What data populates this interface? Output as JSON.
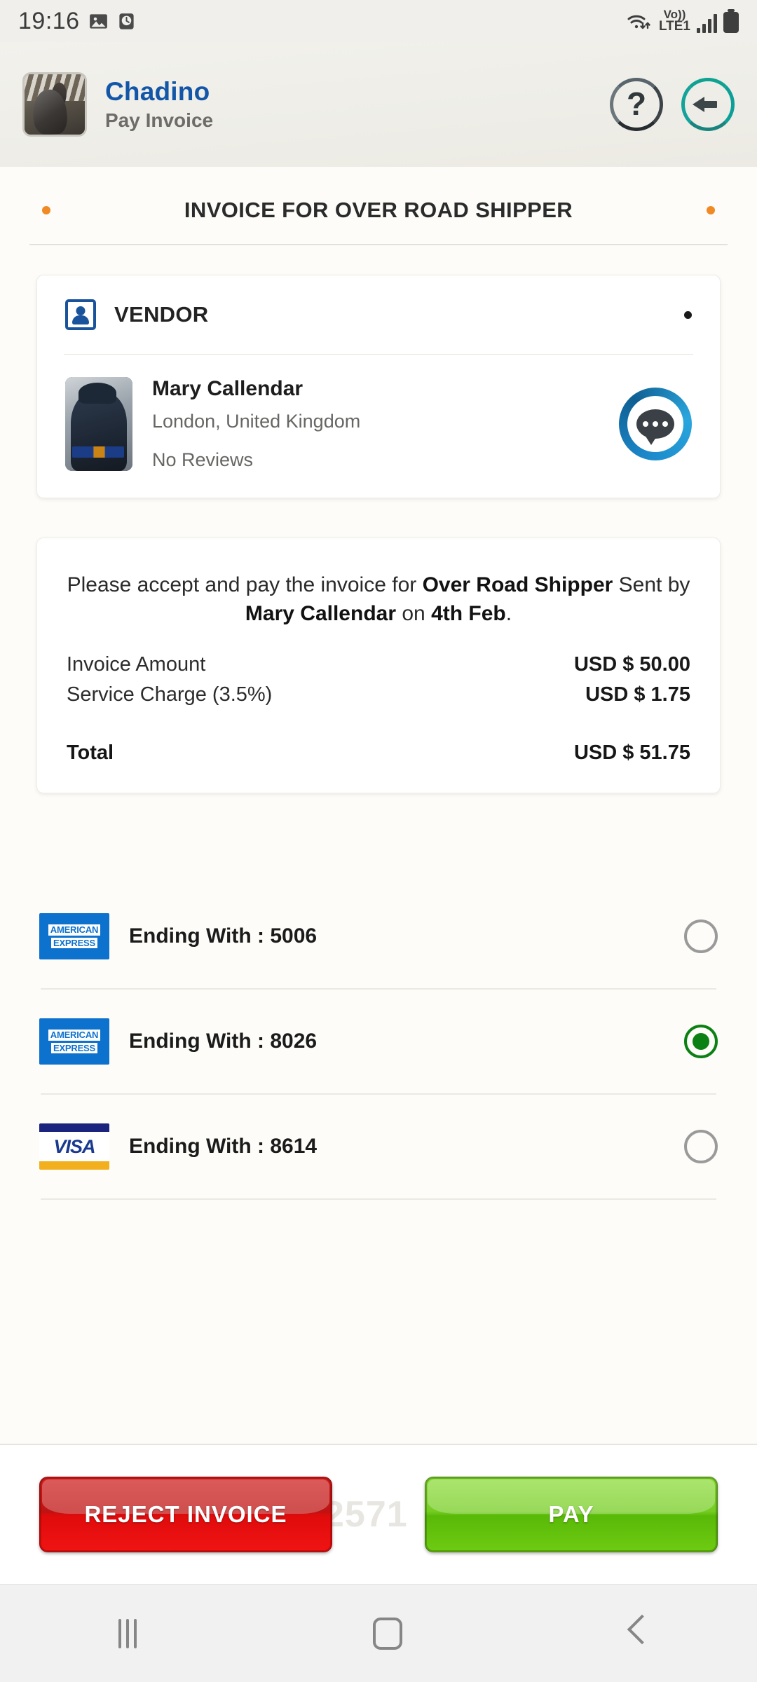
{
  "status_bar": {
    "time": "19:16",
    "left_icons": [
      "image-icon",
      "clock-icon"
    ],
    "network": {
      "volte_line1": "Vo))",
      "volte_line2": "LTE1"
    },
    "right_icons": [
      "wifi-icon",
      "volte-icon",
      "signal-icon",
      "battery-icon"
    ]
  },
  "header": {
    "app_title": "Chadino",
    "screen_subtitle": "Pay Invoice",
    "thumbnail_alt": "horse-stable-photo",
    "help_label": "?",
    "help_icon": "question-mark-icon",
    "back_icon": "arrow-left-icon",
    "title_color": "#1356a8"
  },
  "page": {
    "title": "INVOICE FOR OVER ROAD SHIPPER",
    "bullet_color": "#ef8a25"
  },
  "vendor_card": {
    "section_label": "VENDOR",
    "section_icon": "contact-card-icon",
    "menu_dot": "menu-dot-icon",
    "avatar_alt": "vendor-profile-photo",
    "name": "Mary Callendar",
    "location": "London, United Kingdom",
    "reviews": "No Reviews",
    "chat_icon": "chat-bubble-icon"
  },
  "invoice_card": {
    "message_parts": [
      {
        "text": "Please accept and pay the invoice for ",
        "bold": false
      },
      {
        "text": "Over Road Shipper",
        "bold": true
      },
      {
        "text": " Sent by ",
        "bold": false
      },
      {
        "text": "Mary Callendar",
        "bold": true
      },
      {
        "text": " on ",
        "bold": false
      },
      {
        "text": "4th Feb",
        "bold": true
      },
      {
        "text": ".",
        "bold": false
      }
    ],
    "message_plain": "Please accept and pay the invoice for Over Road Shipper Sent by Mary Callendar on 4th Feb.",
    "lines": [
      {
        "label": "Invoice Amount",
        "value": "USD $ 50.00"
      },
      {
        "label": "Service Charge (3.5%)",
        "value": "USD $ 1.75"
      }
    ],
    "total": {
      "label": "Total",
      "value": "USD $ 51.75"
    }
  },
  "payment_methods": [
    {
      "brand": "amex",
      "brand_line1": "AMERICAN",
      "brand_line2": "EXPRESS",
      "label": "Ending With : 5006",
      "selected": false
    },
    {
      "brand": "amex",
      "brand_line1": "AMERICAN",
      "brand_line2": "EXPRESS",
      "label": "Ending With : 8026",
      "selected": true
    },
    {
      "brand": "visa",
      "brand_text": "VISA",
      "label": "Ending With : 8614",
      "selected": false
    }
  ],
  "actions": {
    "reject_label": "REJECT INVOICE",
    "pay_label": "PAY",
    "watermark": "2571",
    "reject_color": "#d11414",
    "pay_color": "#6ecb12",
    "selected_radio_color": "#0b8013"
  },
  "nav_bar": {
    "recents_icon": "recents-icon",
    "home_icon": "home-icon",
    "back_icon": "back-chevron-icon"
  }
}
